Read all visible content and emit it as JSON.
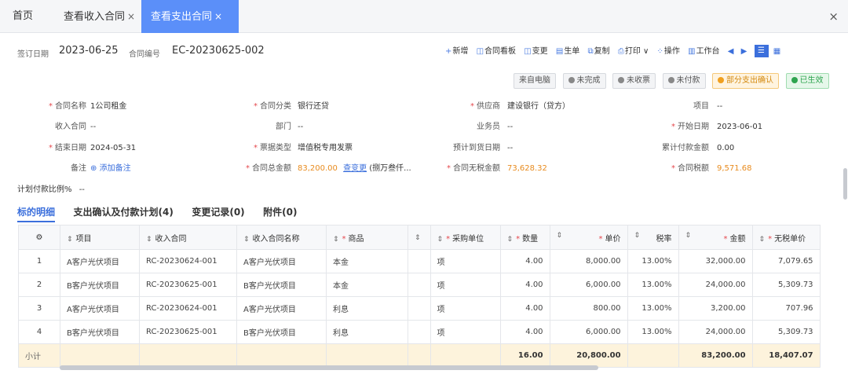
{
  "tabs": {
    "home": "首页",
    "income": "查看收入合同",
    "expense": "查看支出合同",
    "close_tab": "×",
    "close_window": "×"
  },
  "info": {
    "sign_date_label": "签订日期",
    "sign_date": "2023-06-25",
    "contract_no_label": "合同编号",
    "contract_no": "EC-20230625-002"
  },
  "toolbar": {
    "add": "新增",
    "board": "合同看板",
    "change": "变更",
    "generate": "生单",
    "copy": "复制",
    "print": "打印",
    "actions": "操作",
    "workbench": "工作台"
  },
  "status": {
    "source": "来自电脑",
    "incomplete": "未完成",
    "not_received": "未收票",
    "unpaid": "未付款",
    "partial": "部分支出确认",
    "effective": "已生效"
  },
  "form": {
    "name_label": "合同名称",
    "name": "1公司租金",
    "category_label": "合同分类",
    "category": "银行还贷",
    "supplier_label": "供应商",
    "supplier": "建设银行（贷方）",
    "project_label": "项目",
    "project": "--",
    "income_contract_label": "收入合同",
    "income_contract": "--",
    "dept_label": "部门",
    "dept": "--",
    "salesman_label": "业务员",
    "salesman": "--",
    "start_label": "开始日期",
    "start": "2023-06-01",
    "end_label": "结束日期",
    "end": "2024-05-31",
    "invoice_type_label": "票据类型",
    "invoice_type": "增值税专用发票",
    "arrival_label": "预计到货日期",
    "arrival": "--",
    "paid_label": "累计付款金额",
    "paid": "0.00",
    "remark_label": "备注",
    "remark_add": "添加备注",
    "total_label": "合同总金额",
    "total": "83,200.00",
    "total_change": "查变更",
    "total_words": "(捌万叁仟...",
    "notax_label": "合同无税金额",
    "notax": "73,628.32",
    "tax_label": "合同税额",
    "tax": "9,571.68",
    "plan_ratio_label": "计划付款比例%",
    "plan_ratio": "--"
  },
  "subtabs": [
    "标的明细",
    "支出确认及付款计划(4)",
    "变更记录(0)",
    "附件(0)"
  ],
  "table": {
    "headers": [
      "项目",
      "收入合同",
      "收入合同名称",
      "商品",
      "采购单位",
      "数量",
      "单价",
      "税率",
      "金额",
      "无税单价"
    ],
    "rows": [
      [
        "1",
        "A客户光伏项目",
        "RC-20230624-001",
        "A客户光伏项目",
        "本金",
        "",
        "项",
        "4.00",
        "8,000.00",
        "13.00%",
        "32,000.00",
        "7,079.65"
      ],
      [
        "2",
        "B客户光伏项目",
        "RC-20230625-001",
        "B客户光伏项目",
        "本金",
        "",
        "项",
        "4.00",
        "6,000.00",
        "13.00%",
        "24,000.00",
        "5,309.73"
      ],
      [
        "3",
        "A客户光伏项目",
        "RC-20230624-001",
        "A客户光伏项目",
        "利息",
        "",
        "项",
        "4.00",
        "800.00",
        "13.00%",
        "3,200.00",
        "707.96"
      ],
      [
        "4",
        "B客户光伏项目",
        "RC-20230625-001",
        "B客户光伏项目",
        "利息",
        "",
        "项",
        "4.00",
        "6,000.00",
        "13.00%",
        "24,000.00",
        "5,309.73"
      ]
    ],
    "subtotal": {
      "label": "小计",
      "qty": "16.00",
      "price": "20,800.00",
      "amount": "83,200.00",
      "notax": "18,407.07"
    }
  }
}
